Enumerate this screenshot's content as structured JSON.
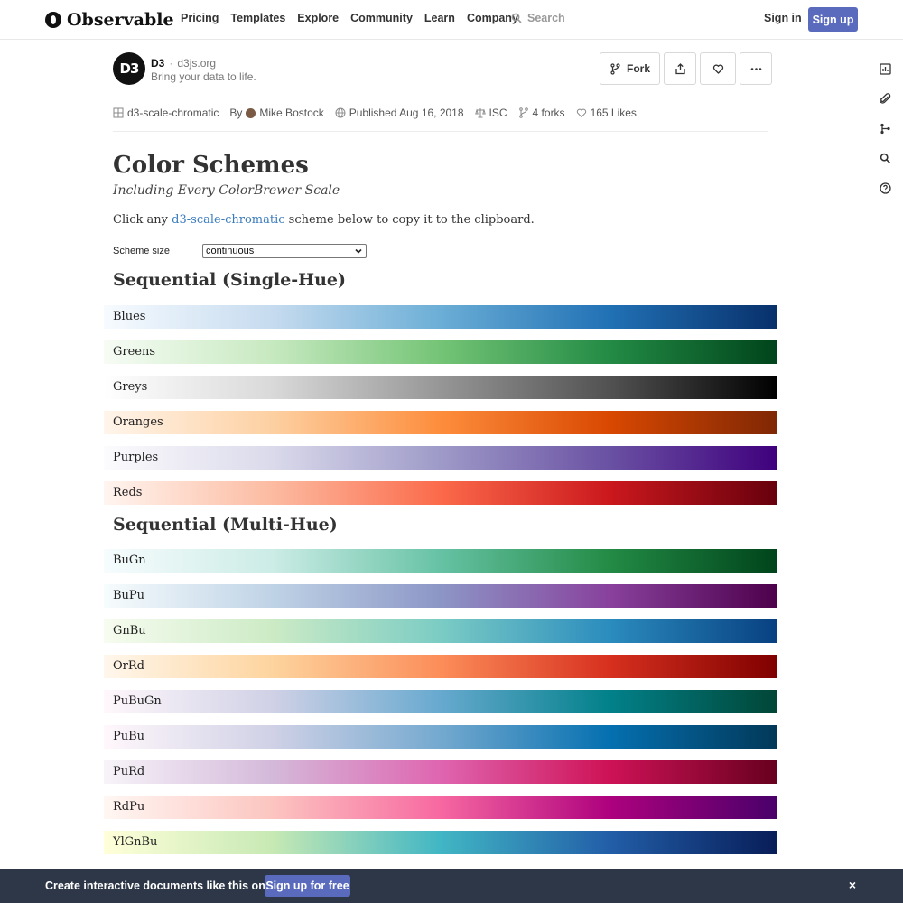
{
  "nav": {
    "logo": "Observable",
    "links": [
      "Pricing",
      "Templates",
      "Explore",
      "Community",
      "Learn",
      "Company"
    ],
    "search_placeholder": "Search",
    "signin": "Sign in",
    "signup": "Sign up"
  },
  "notebook": {
    "owner": "D3",
    "owner_site": "d3js.org",
    "tagline": "Bring your data to life.",
    "fork_label": "Fork",
    "meta": {
      "collection": "d3-scale-chromatic",
      "by": "By",
      "author": "Mike Bostock",
      "published": "Published Aug 16, 2018",
      "license": "ISC",
      "forks": "4 forks",
      "likes": "165 Likes"
    }
  },
  "content": {
    "title": "Color Schemes",
    "subtitle": "Including Every ColorBrewer Scale",
    "intro_before": "Click any ",
    "intro_link": "d3-scale-chromatic",
    "intro_after": " scheme below to copy it to the clipboard.",
    "scheme_size_label": "Scheme size",
    "scheme_size_value": "continuous",
    "sections": [
      {
        "title": "Sequential (Single-Hue)",
        "schemes": [
          {
            "name": "Blues",
            "colors": [
              "#f7fbff",
              "#c6dbef",
              "#6baed6",
              "#2171b5",
              "#08306b"
            ]
          },
          {
            "name": "Greens",
            "colors": [
              "#f7fcf5",
              "#c7e9c0",
              "#74c476",
              "#238b45",
              "#00441b"
            ]
          },
          {
            "name": "Greys",
            "colors": [
              "#ffffff",
              "#d9d9d9",
              "#969696",
              "#525252",
              "#000000"
            ]
          },
          {
            "name": "Oranges",
            "colors": [
              "#fff5eb",
              "#fdd0a2",
              "#fd8d3c",
              "#d94801",
              "#7f2704"
            ]
          },
          {
            "name": "Purples",
            "colors": [
              "#fcfbfd",
              "#dadaeb",
              "#9e9ac8",
              "#6a51a3",
              "#3f007d"
            ]
          },
          {
            "name": "Reds",
            "colors": [
              "#fff5f0",
              "#fcbba1",
              "#fb6a4a",
              "#cb181d",
              "#67000d"
            ]
          }
        ]
      },
      {
        "title": "Sequential (Multi-Hue)",
        "schemes": [
          {
            "name": "BuGn",
            "colors": [
              "#f7fcfd",
              "#ccece6",
              "#66c2a4",
              "#238b45",
              "#00441b"
            ]
          },
          {
            "name": "BuPu",
            "colors": [
              "#f7fcfd",
              "#bfd3e6",
              "#8c96c6",
              "#88419d",
              "#4d004b"
            ]
          },
          {
            "name": "GnBu",
            "colors": [
              "#f7fcf0",
              "#ccebc5",
              "#7bccc4",
              "#2b8cbe",
              "#084081"
            ]
          },
          {
            "name": "OrRd",
            "colors": [
              "#fff7ec",
              "#fdd49e",
              "#fc8d59",
              "#d7301f",
              "#7f0000"
            ]
          },
          {
            "name": "PuBuGn",
            "colors": [
              "#fff7fb",
              "#d0d1e6",
              "#67a9cf",
              "#02818a",
              "#014636"
            ]
          },
          {
            "name": "PuBu",
            "colors": [
              "#fff7fb",
              "#d0d1e6",
              "#74a9cf",
              "#0570b0",
              "#023858"
            ]
          },
          {
            "name": "PuRd",
            "colors": [
              "#f7f4f9",
              "#d4b9da",
              "#df65b0",
              "#ce1256",
              "#67001f"
            ]
          },
          {
            "name": "RdPu",
            "colors": [
              "#fff7f3",
              "#fcc5c0",
              "#f768a1",
              "#ae017e",
              "#49006a"
            ]
          },
          {
            "name": "YlGnBu",
            "colors": [
              "#ffffd9",
              "#c7e9b4",
              "#41b6c4",
              "#225ea8",
              "#081d58"
            ]
          }
        ]
      }
    ]
  },
  "banner": {
    "text": "Create interactive documents like this one.",
    "button": "Sign up for free",
    "close": "×"
  },
  "colors": {
    "accent": "#5a6bbd",
    "link": "#3a7bbf",
    "banner_bg": "#2d3748"
  }
}
